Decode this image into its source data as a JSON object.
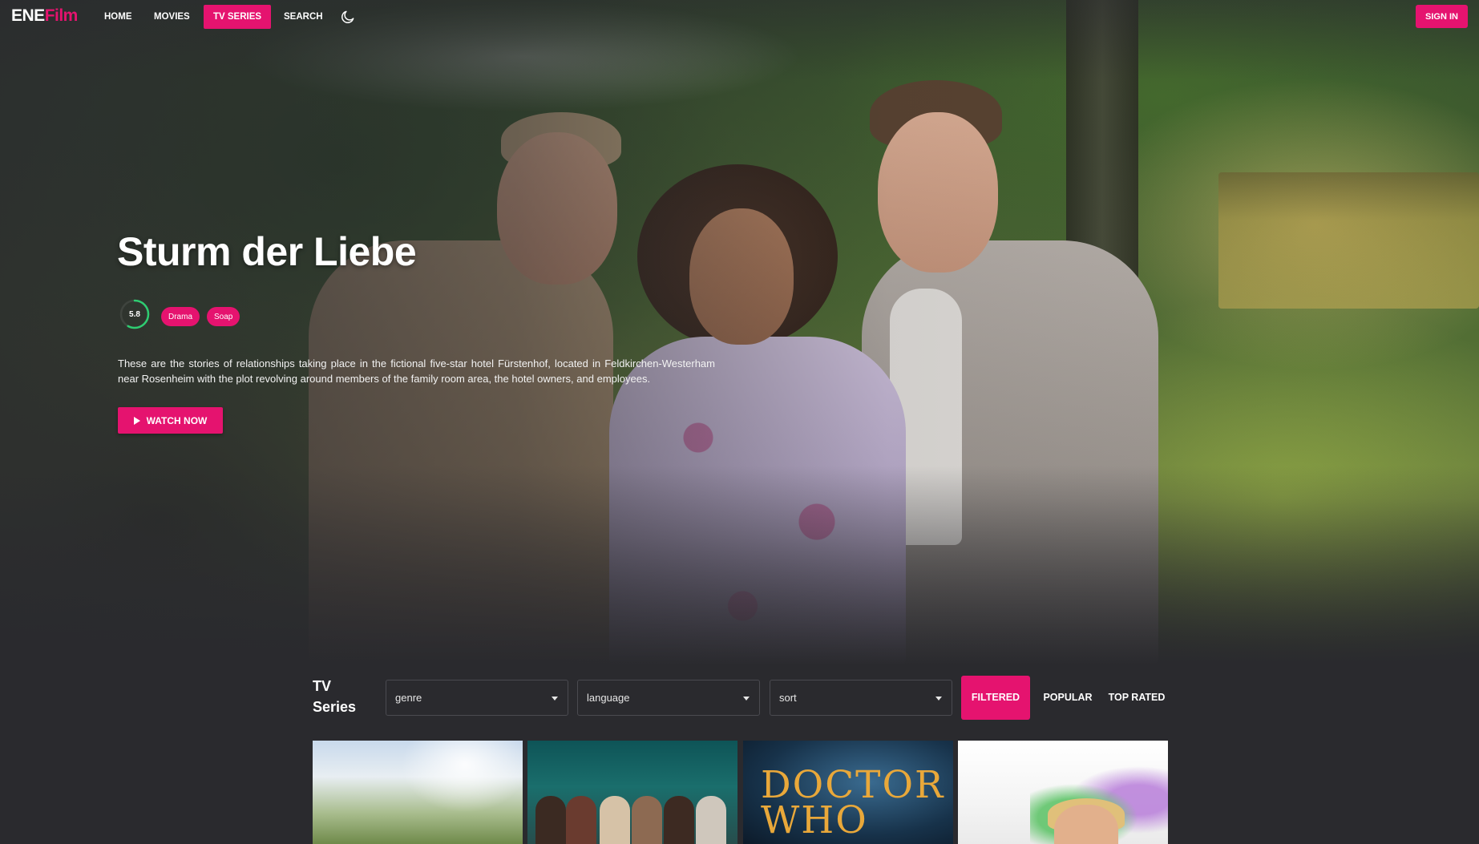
{
  "brand": {
    "part1": "ENE",
    "part2": "Film"
  },
  "nav": {
    "items": [
      {
        "label": "HOME",
        "active": false
      },
      {
        "label": "MOVIES",
        "active": false
      },
      {
        "label": "TV SERIES",
        "active": true
      },
      {
        "label": "SEARCH",
        "active": false
      }
    ],
    "theme_icon": "moon-icon",
    "signin_label": "SIGN IN"
  },
  "hero": {
    "title": "Sturm der Liebe",
    "rating": "5.8",
    "rating_fraction": 0.58,
    "genres": [
      "Drama",
      "Soap"
    ],
    "overview": "These are the stories of relationships taking place in the fictional five-star hotel Fürstenhof, located in Feldkirchen-Westerham near Rosenheim with the plot revolving around members of the family room area, the hotel owners, and employees.",
    "watch_label": "WATCH NOW"
  },
  "section": {
    "title": "TV Series",
    "filters": {
      "genre": "genre",
      "language": "language",
      "sort": "sort"
    },
    "tabs": [
      {
        "label": "FILTERED",
        "active": true
      },
      {
        "label": "POPULAR",
        "active": false
      },
      {
        "label": "TOP RATED",
        "active": false
      }
    ]
  },
  "posters": {
    "doctor_who_text": "DOCTOR WHO"
  },
  "colors": {
    "accent": "#e5136f",
    "background": "#2a2a2e",
    "rating_ring": "#2ecc71"
  }
}
